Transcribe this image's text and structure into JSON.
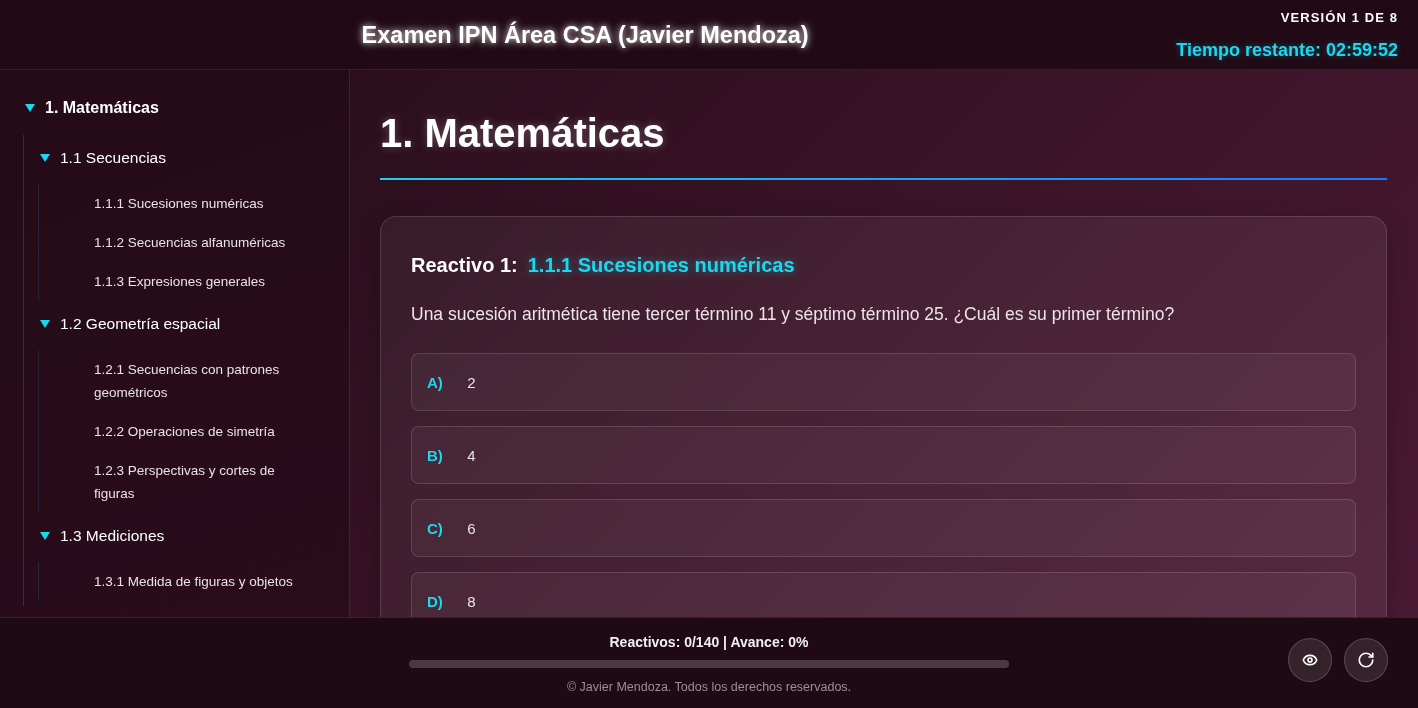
{
  "header": {
    "title": "Examen IPN Área CSA (Javier Mendoza)",
    "version": "VERSIÓN 1 DE 8",
    "timer": "Tiempo restante: 02:59:52"
  },
  "sidebar": {
    "items": [
      {
        "label": "1. Matemáticas",
        "expanded": true,
        "children": [
          {
            "label": "1.1 Secuencias",
            "expanded": true,
            "children": [
              {
                "label": "1.1.1 Sucesiones numéricas"
              },
              {
                "label": "1.1.2 Secuencias alfanuméricas"
              },
              {
                "label": "1.1.3 Expresiones generales"
              }
            ]
          },
          {
            "label": "1.2 Geometría espacial",
            "expanded": true,
            "children": [
              {
                "label": "1.2.1 Secuencias con patrones geométricos"
              },
              {
                "label": "1.2.2 Operaciones de simetría"
              },
              {
                "label": "1.2.3 Perspectivas y cortes de figuras"
              }
            ]
          },
          {
            "label": "1.3 Mediciones",
            "expanded": true,
            "children": [
              {
                "label": "1.3.1 Medida de figuras y objetos"
              }
            ]
          }
        ]
      }
    ]
  },
  "section": {
    "title": "1. Matemáticas"
  },
  "question": {
    "label": "Reactivo 1:",
    "topic": "1.1.1 Sucesiones numéricas",
    "text": "Una sucesión aritmética tiene tercer término 11 y séptimo término 25. ¿Cuál es su primer término?",
    "options": [
      {
        "letter": "A)",
        "text": "2",
        "selected": false
      },
      {
        "letter": "B)",
        "text": "4",
        "selected": false
      },
      {
        "letter": "C)",
        "text": "6",
        "selected": false
      },
      {
        "letter": "D)",
        "text": "8",
        "selected": false
      }
    ]
  },
  "footer": {
    "progress_text": "Reactivos: 0/140 | Avance: 0%",
    "progress": {
      "level": 0
    },
    "copyright": "© Javier Mendoza. Todos los derechos reservados."
  }
}
